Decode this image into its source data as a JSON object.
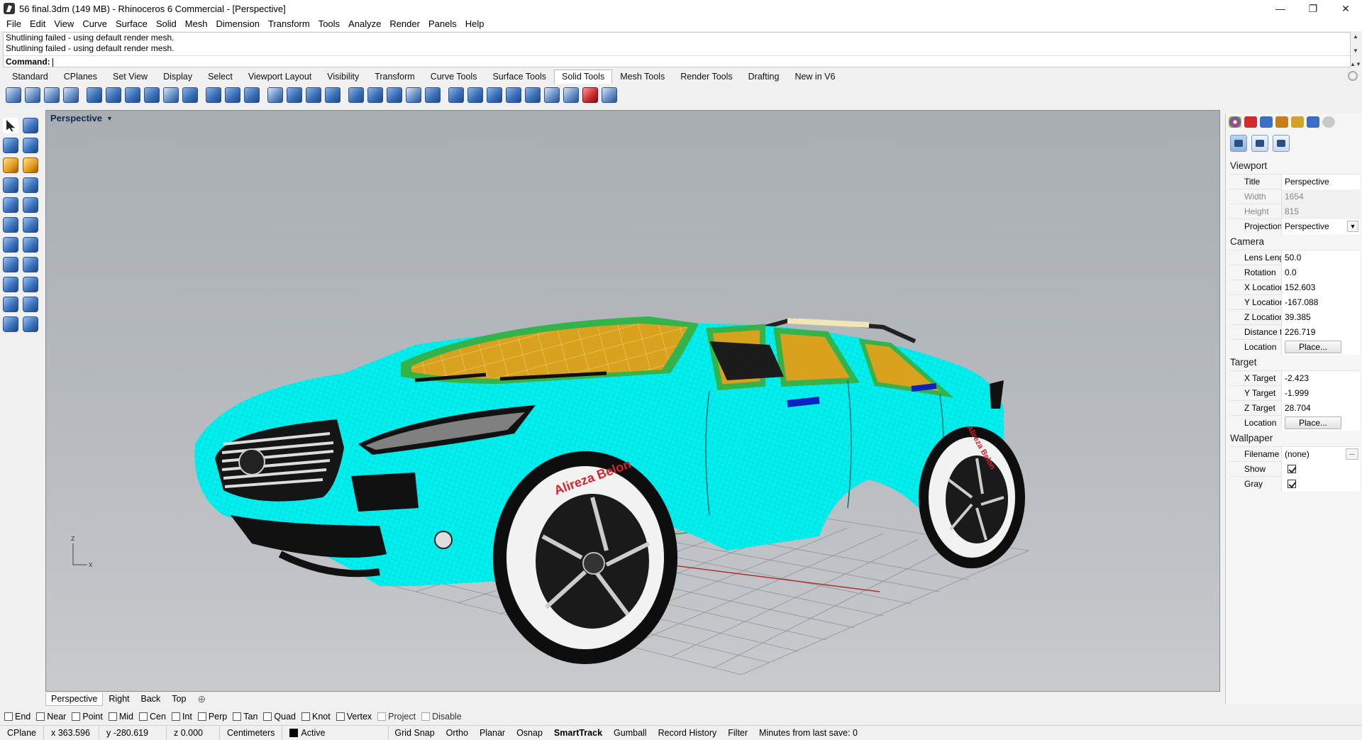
{
  "window": {
    "title": "56 final.3dm (149 MB) - Rhinoceros 6 Commercial - [Perspective]",
    "minimize": "—",
    "restore": "❐",
    "close": "✕"
  },
  "menu": [
    "File",
    "Edit",
    "View",
    "Curve",
    "Surface",
    "Solid",
    "Mesh",
    "Dimension",
    "Transform",
    "Tools",
    "Analyze",
    "Render",
    "Panels",
    "Help"
  ],
  "command": {
    "history": [
      "Shutlining failed - using default render mesh.",
      "Shutlining failed - using default render mesh."
    ],
    "prompt_label": "Command:",
    "value": ""
  },
  "toolbar_tabs": [
    "Standard",
    "CPlanes",
    "Set View",
    "Display",
    "Select",
    "Viewport Layout",
    "Visibility",
    "Transform",
    "Curve Tools",
    "Surface Tools",
    "Solid Tools",
    "Mesh Tools",
    "Render Tools",
    "Drafting",
    "New in V6"
  ],
  "active_toolbar_tab": "Solid Tools",
  "viewport": {
    "title": "Perspective",
    "axis_z": "z",
    "axis_x": "x",
    "wheel_text": "Alireza Belon",
    "colors": {
      "body": "#00f0f0",
      "glass": "#d9a21e",
      "trim": "#3db13d"
    }
  },
  "viewport_tabs": [
    "Perspective",
    "Right",
    "Back",
    "Top"
  ],
  "viewport_tab_add": "⊕",
  "osnaps": [
    {
      "label": "End",
      "enabled": true
    },
    {
      "label": "Near",
      "enabled": true
    },
    {
      "label": "Point",
      "enabled": true
    },
    {
      "label": "Mid",
      "enabled": true
    },
    {
      "label": "Cen",
      "enabled": true
    },
    {
      "label": "Int",
      "enabled": true
    },
    {
      "label": "Perp",
      "enabled": true
    },
    {
      "label": "Tan",
      "enabled": true
    },
    {
      "label": "Quad",
      "enabled": true
    },
    {
      "label": "Knot",
      "enabled": true
    },
    {
      "label": "Vertex",
      "enabled": true
    },
    {
      "label": "Project",
      "enabled": false
    },
    {
      "label": "Disable",
      "enabled": false
    }
  ],
  "status": {
    "cplane": "CPlane",
    "x": "x 363.596",
    "y": "y -280.619",
    "z": "z 0.000",
    "units": "Centimeters",
    "layer": "Active",
    "toggles": [
      {
        "label": "Grid Snap",
        "on": false
      },
      {
        "label": "Ortho",
        "on": false
      },
      {
        "label": "Planar",
        "on": false
      },
      {
        "label": "Osnap",
        "on": false
      },
      {
        "label": "SmartTrack",
        "on": true
      },
      {
        "label": "Gumball",
        "on": false
      },
      {
        "label": "Record History",
        "on": false
      },
      {
        "label": "Filter",
        "on": false
      }
    ],
    "last_save": "Minutes from last save: 0"
  },
  "panel": {
    "tab_colors": [
      "#e23b3b",
      "#d12c2c",
      "#3a6fc4",
      "#c77c1e",
      "#d4a22a",
      "#3a6fc4",
      "#b0b0b0"
    ],
    "sections": {
      "viewport": "Viewport",
      "camera": "Camera",
      "target": "Target",
      "wallpaper": "Wallpaper"
    },
    "viewport_props": {
      "title_k": "Title",
      "title_v": "Perspective",
      "width_k": "Width",
      "width_v": "1654",
      "height_k": "Height",
      "height_v": "815",
      "proj_k": "Projection",
      "proj_v": "Perspective"
    },
    "camera_props": {
      "lens_k": "Lens Length",
      "lens_v": "50.0",
      "rot_k": "Rotation",
      "rot_v": "0.0",
      "xl_k": "X Location",
      "xl_v": "152.603",
      "yl_k": "Y Location",
      "yl_v": "-167.088",
      "zl_k": "Z Location",
      "zl_v": "39.385",
      "dist_k": "Distance t...",
      "dist_v": "226.719",
      "loc_k": "Location",
      "loc_btn": "Place..."
    },
    "target_props": {
      "xt_k": "X Target",
      "xt_v": "-2.423",
      "yt_k": "Y Target",
      "yt_v": "-1.999",
      "zt_k": "Z Target",
      "zt_v": "28.704",
      "loc_k": "Location",
      "loc_btn": "Place..."
    },
    "wallpaper_props": {
      "file_k": "Filename",
      "file_v": "(none)",
      "file_btn": "...",
      "show_k": "Show",
      "show": true,
      "gray_k": "Gray",
      "gray": true
    }
  }
}
